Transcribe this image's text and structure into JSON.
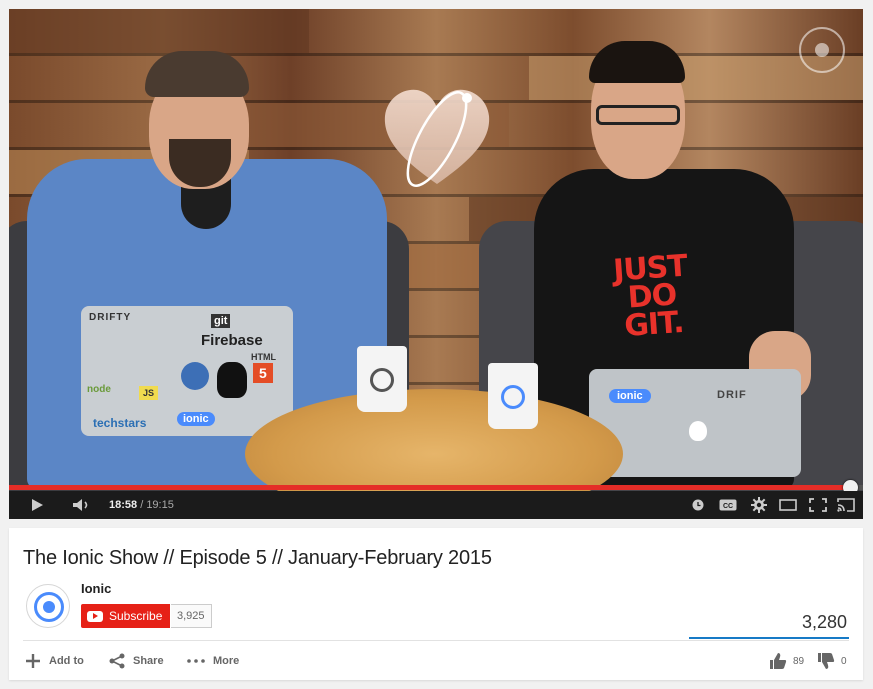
{
  "player": {
    "current_time": "18:58",
    "separator": " / ",
    "duration": "19:15",
    "progress_fraction": 0.985,
    "laptop_left_stickers": [
      "DRIFTY",
      "git",
      "Firebase",
      "HTML",
      "5",
      "node",
      "JS",
      "techstars",
      "ionic"
    ],
    "laptop_right_stickers": [
      "ionic",
      "DRIF"
    ],
    "shirt_text": [
      "JUST",
      "DO",
      "GIT."
    ],
    "accent_color": "#e52d27"
  },
  "video": {
    "title": "The Ionic Show // Episode 5 // January-February 2015",
    "channel_name": "Ionic",
    "subscribe_label": "Subscribe",
    "subscriber_count": "3,925",
    "view_count": "3,280"
  },
  "actions": {
    "add_to": "Add to",
    "share": "Share",
    "more": "More",
    "likes": "89",
    "dislikes": "0"
  },
  "icons": {
    "play": "play-icon",
    "volume": "volume-icon",
    "watch_later": "clock-icon",
    "captions": "cc-icon",
    "settings": "gear-icon",
    "theater": "theater-mode-icon",
    "fullscreen": "fullscreen-icon",
    "cast": "cast-icon"
  }
}
